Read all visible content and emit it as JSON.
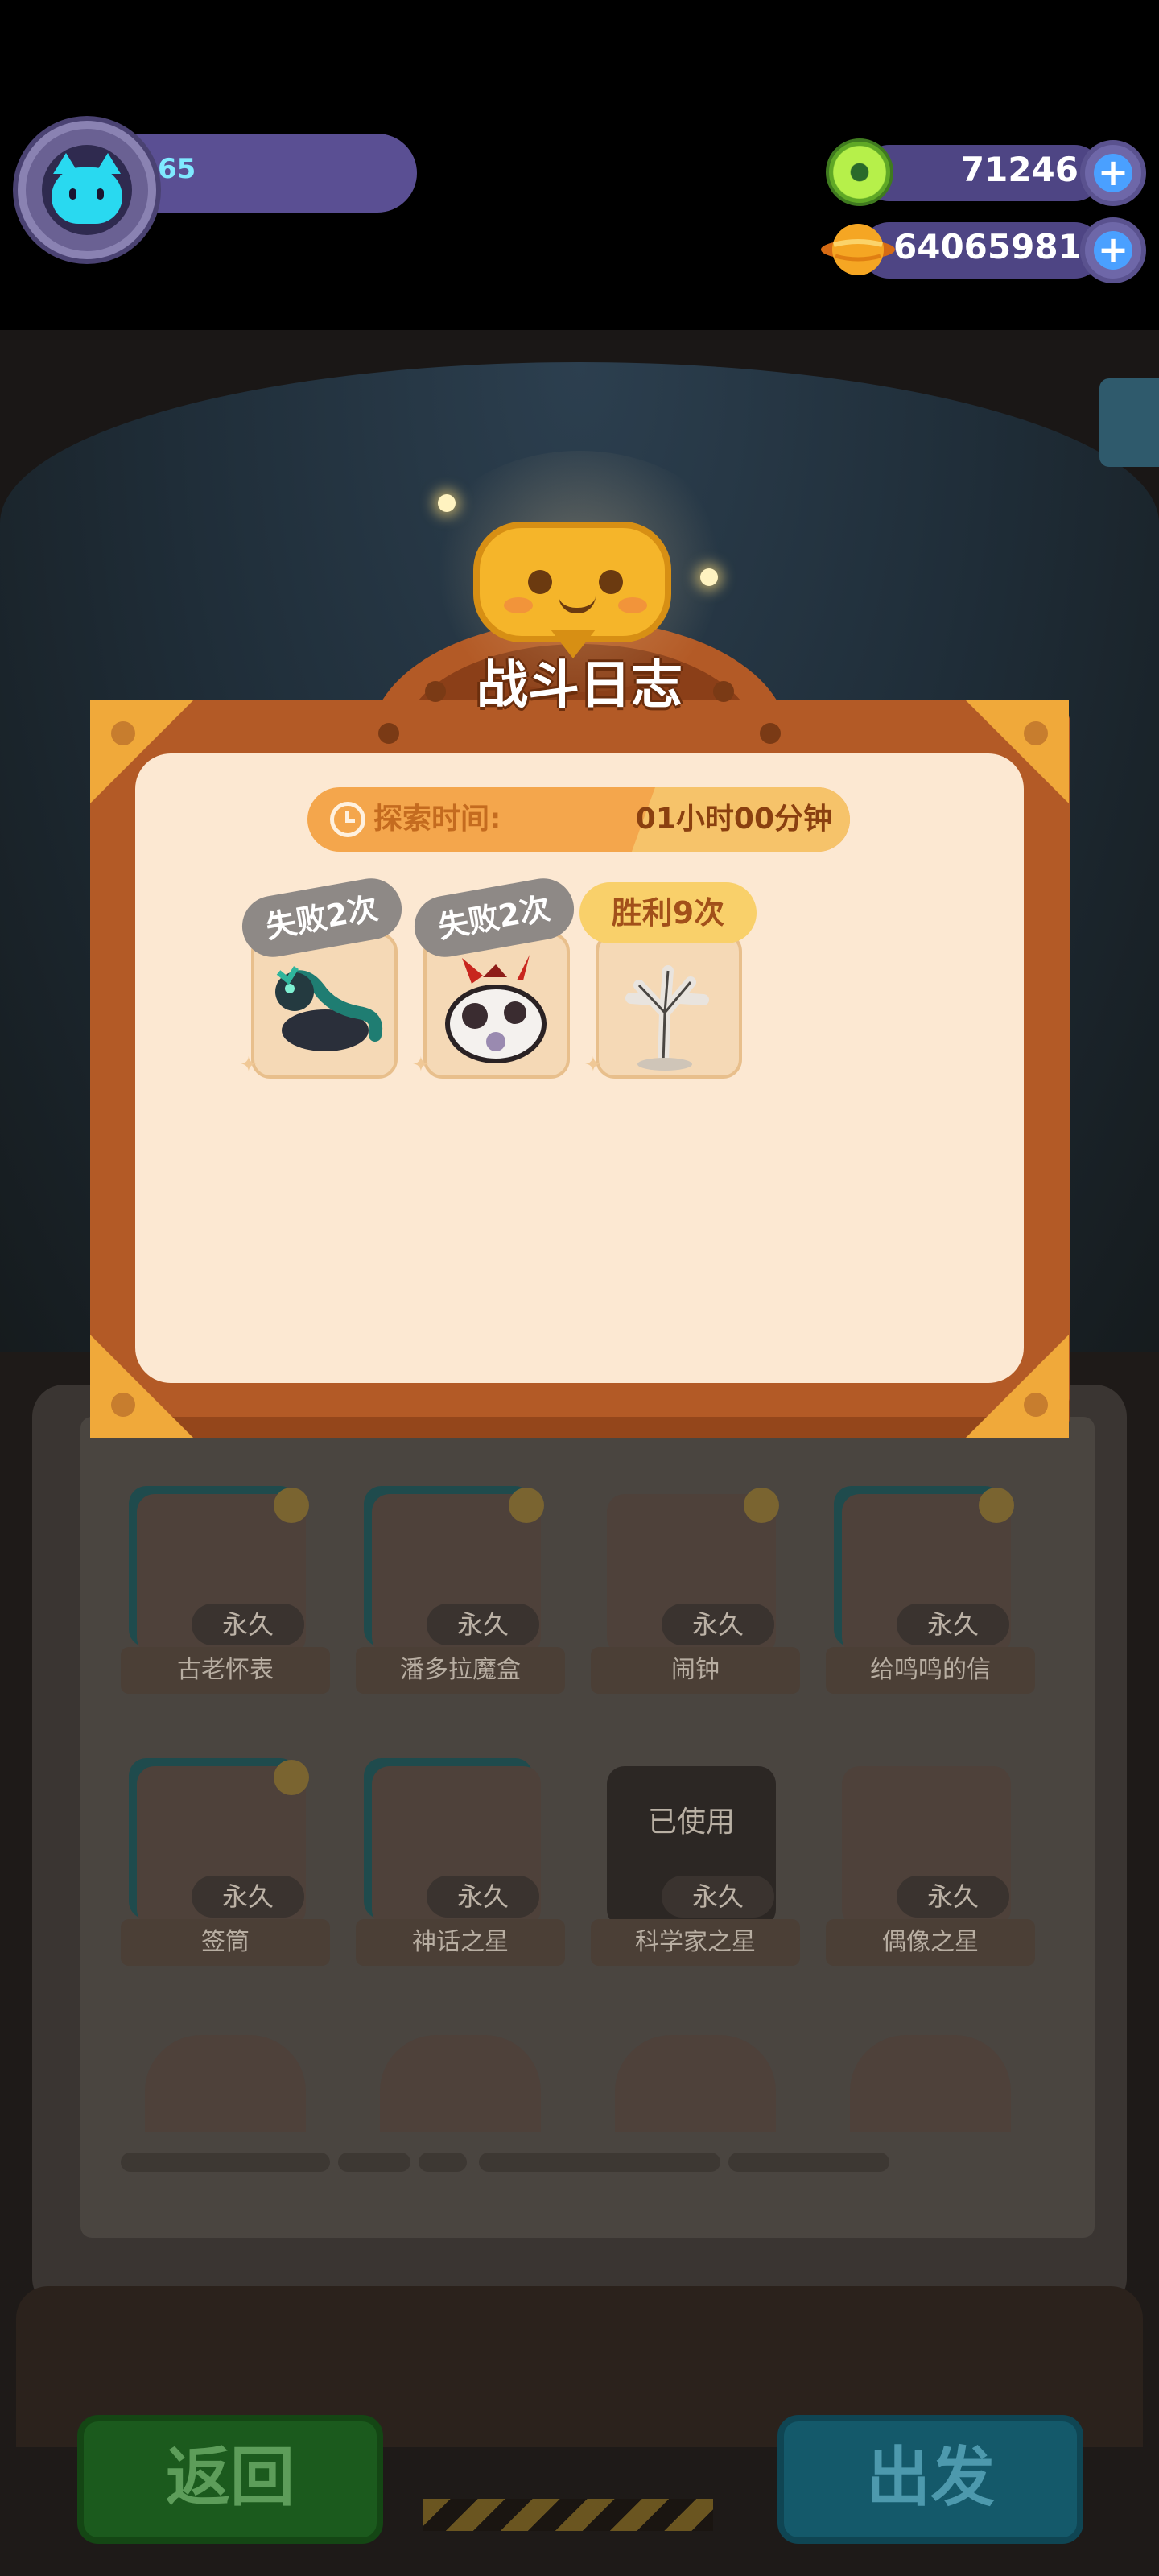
{
  "hud": {
    "player": {
      "level": "65",
      "avatar_icon": "cyan-cat-avatar-icon"
    },
    "currencies": [
      {
        "icon": "green-gem-coin-icon",
        "value": "71246",
        "add_icon": "plus-icon"
      },
      {
        "icon": "orange-planet-coin-icon",
        "value": "64065981",
        "add_icon": "plus-icon"
      }
    ]
  },
  "modal": {
    "title": "战斗日志",
    "title_icon": "smiling-speech-bubble-icon",
    "explore_time": {
      "label": "探索时间:",
      "value": "01小时00分钟",
      "icon": "clock-icon"
    },
    "battles": [
      {
        "tag": "失败2次",
        "result": "lose",
        "creature": "green-dragon-creature-icon"
      },
      {
        "tag": "失败2次",
        "result": "lose",
        "creature": "red-horned-spotted-beast-icon"
      },
      {
        "tag": "胜利9次",
        "result": "win",
        "creature": "white-tree-creature-icon"
      }
    ]
  },
  "background_grid": {
    "row1": [
      {
        "badge": "永久",
        "label": "古老怀表",
        "icon": "pocket-watch-icon"
      },
      {
        "badge": "永久",
        "label": "潘多拉魔盒",
        "icon": "pandora-box-icon"
      },
      {
        "badge": "永久",
        "label": "闹钟",
        "icon": "alarm-clock-icon"
      },
      {
        "badge": "永久",
        "label": "给鸣鸣的信",
        "icon": "letter-envelope-icon"
      }
    ],
    "row2": [
      {
        "badge": "永久",
        "label": "签筒",
        "icon": "fortune-sticks-icon"
      },
      {
        "badge": "永久",
        "label": "神话之星",
        "icon": "myth-star-icon"
      },
      {
        "badge": "永久",
        "label": "科学家之星",
        "icon": "scientist-star-icon",
        "overlay": "已使用"
      },
      {
        "badge": "永久",
        "label": "偶像之星",
        "icon": "idol-star-icon"
      }
    ]
  },
  "buttons": {
    "back": "返回",
    "go": "出发"
  },
  "colors": {
    "modal_frame": "#b35a26",
    "modal_inner": "#fce8d2",
    "lose_tag": "#8e8986",
    "win_tag": "#f9d06a",
    "time_bar": "#f4a64c"
  }
}
